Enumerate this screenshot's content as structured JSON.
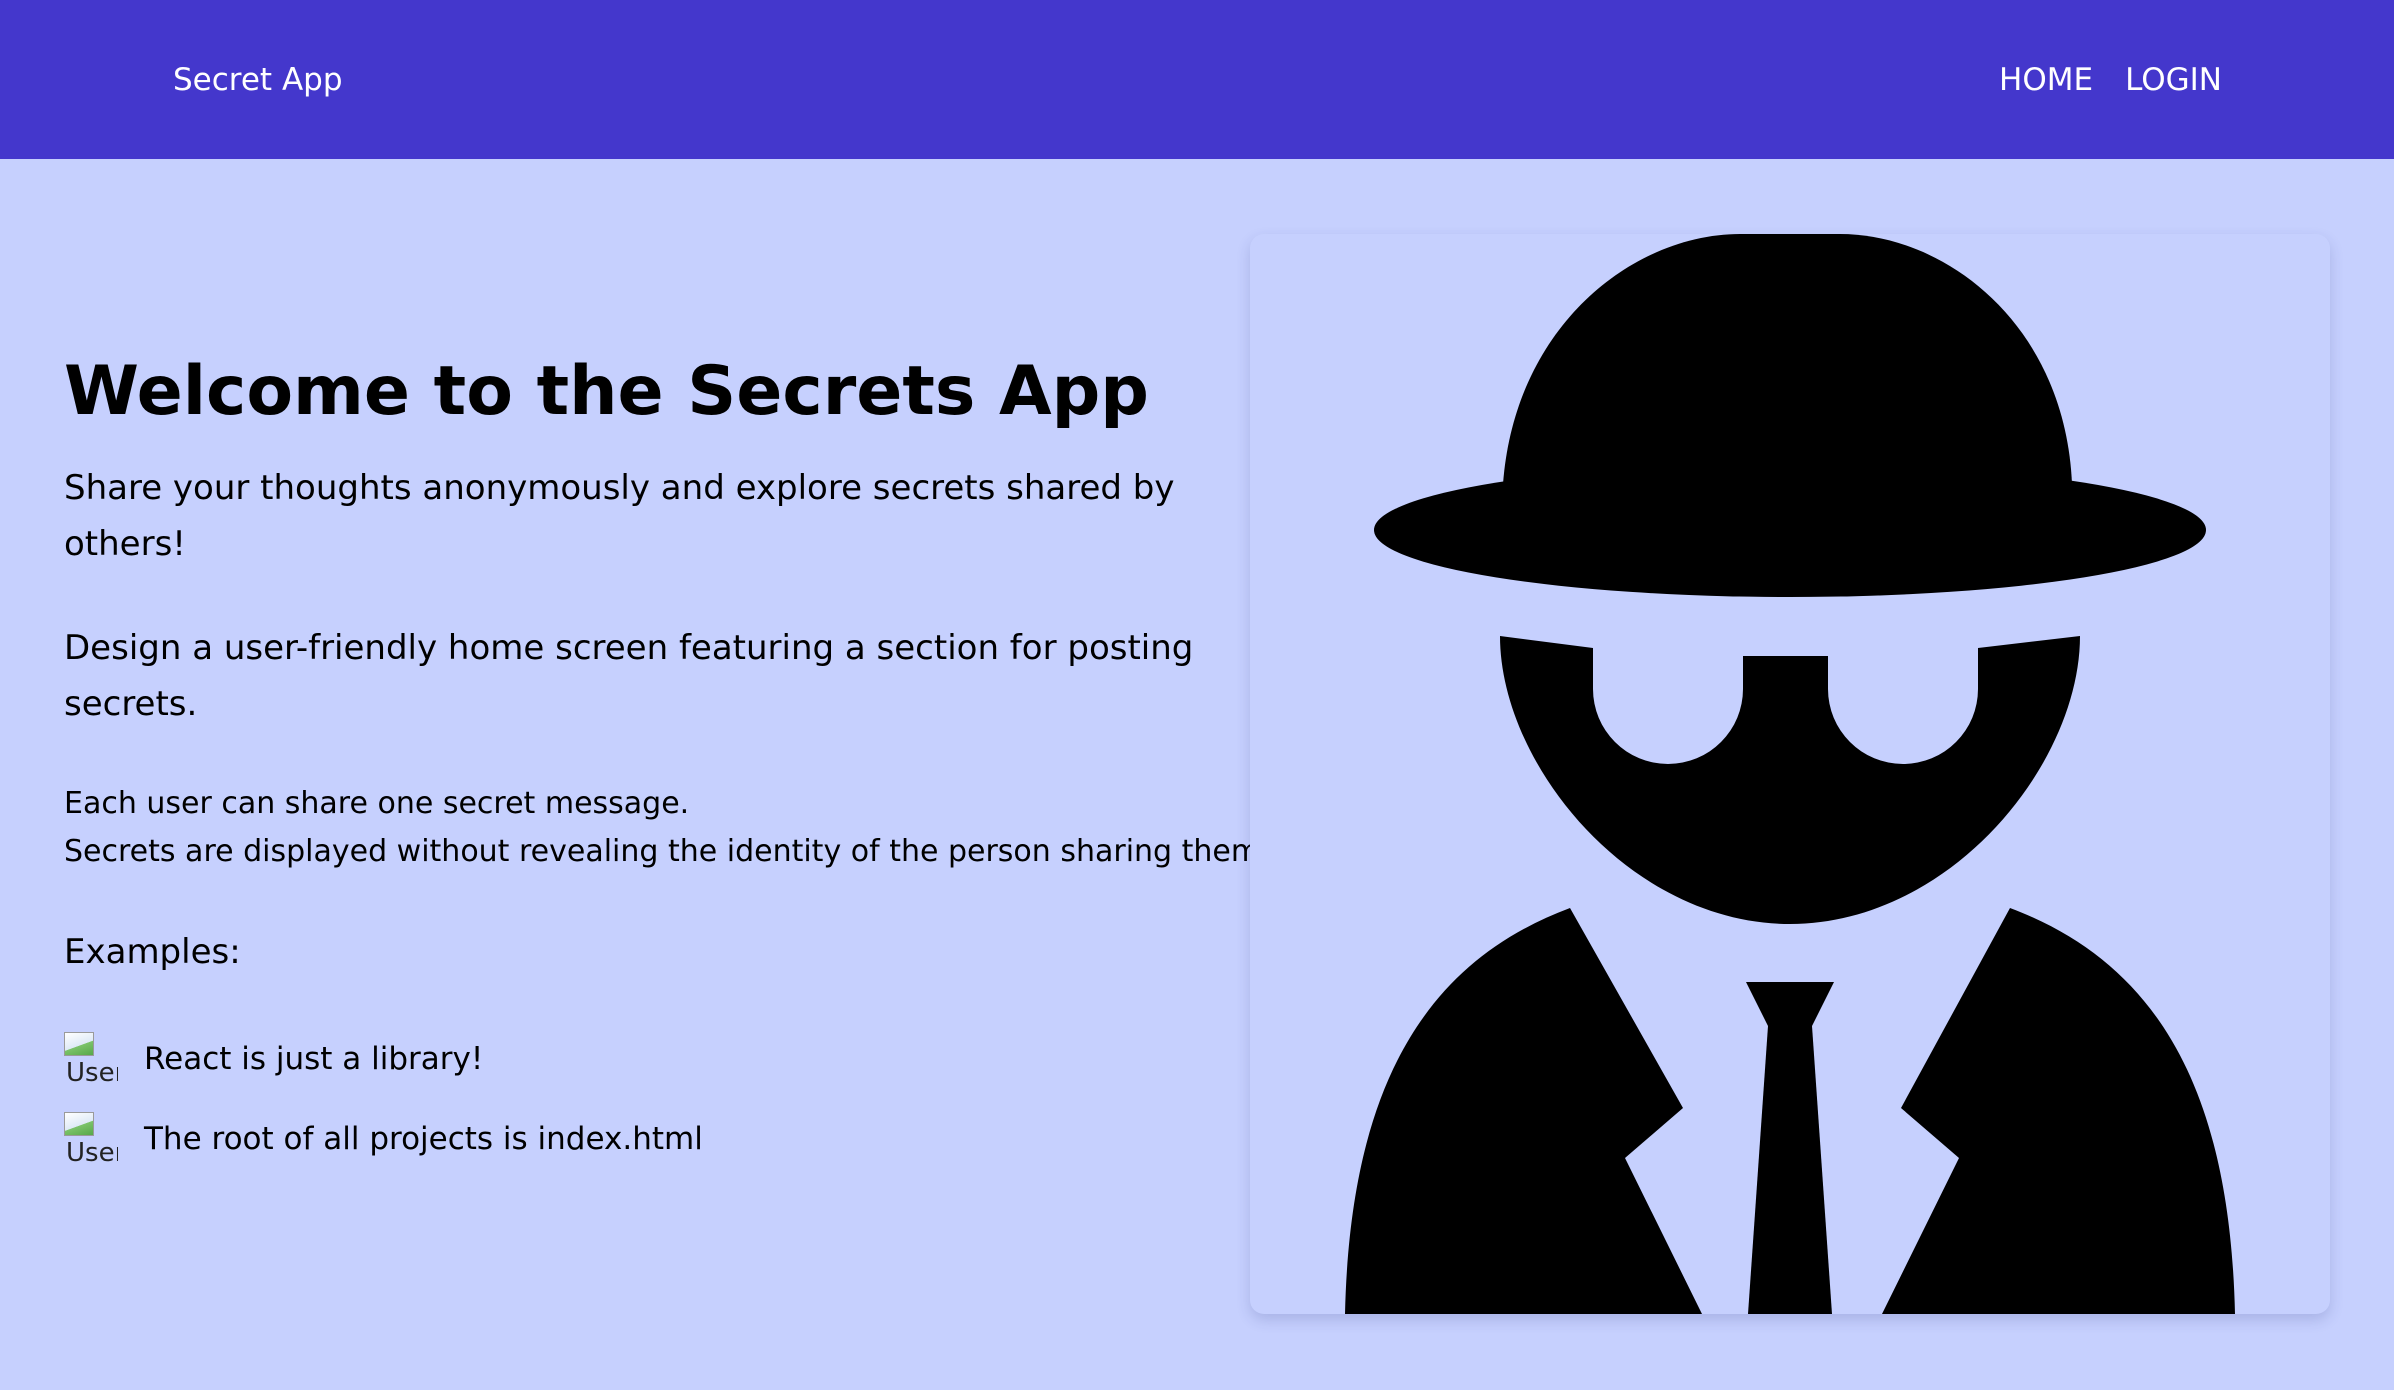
{
  "navbar": {
    "brand": "Secret App",
    "links": [
      "HOME",
      "LOGIN"
    ]
  },
  "hero": {
    "title": "Welcome to the Secrets App",
    "intro": "Share your thoughts anonymously and explore secrets shared by others!",
    "design": "Design a user-friendly home screen featuring a section for posting secrets.",
    "rule_1": "Each user can share one secret message.",
    "rule_2": "Secrets are displayed without revealing the identity of the person sharing them.",
    "examples_label": "Examples:",
    "examples": [
      {
        "text": "React is just a library!",
        "image_alt": "User"
      },
      {
        "text": "The root of all projects is index.html",
        "image_alt": "User"
      }
    ]
  },
  "illustration": {
    "icon": "spy-icon"
  },
  "colors": {
    "navbar": "#4437cc",
    "background": "#c6d0fe",
    "text": "#000000",
    "nav_text": "#ffffff"
  }
}
